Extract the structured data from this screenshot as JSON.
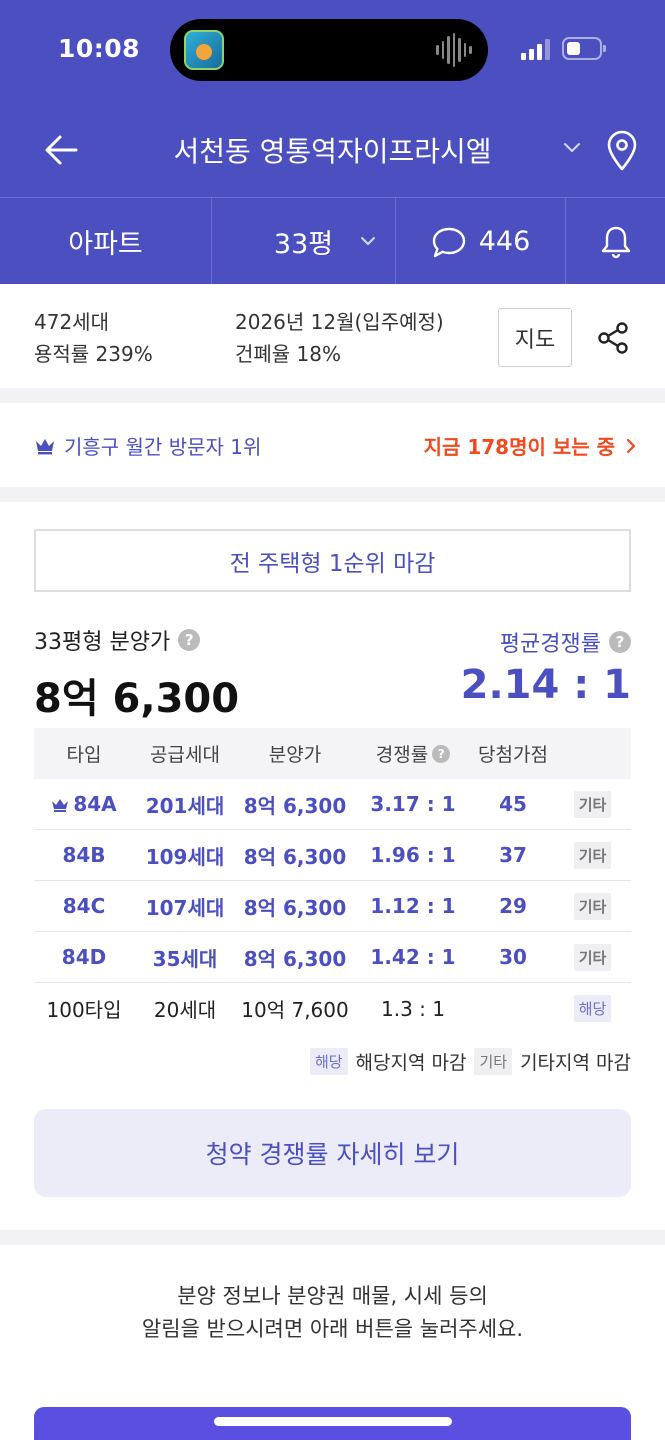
{
  "status_bar": {
    "time": "10:08"
  },
  "header": {
    "title": "서천동 영통역자이프라시엘",
    "tabs": {
      "type": "아파트",
      "size": "33평",
      "comments": "446"
    }
  },
  "info": {
    "households": "472세대",
    "far": "용적률 239%",
    "move_in": "2026년 12월(입주예정)",
    "bcr": "건폐율 18%",
    "map_label": "지도"
  },
  "visit": {
    "rank_text": "기흥구 월간 방문자 1위",
    "viewing_text": "지금 178명이 보는 중"
  },
  "subscription": {
    "closed_text": "전 주택형 1순위 마감",
    "price_label": "33평형 분양가",
    "price_value": "8억 6,300",
    "comp_label": "평균경쟁률",
    "comp_value": "2.14 : 1",
    "table": {
      "headers": [
        "타입",
        "공급세대",
        "분양가",
        "경쟁률",
        "당첨가점"
      ],
      "rows": [
        {
          "type": "84A",
          "supply": "201세대",
          "price": "8억 6,300",
          "ratio": "3.17 : 1",
          "score": "45",
          "tag": "기타"
        },
        {
          "type": "84B",
          "supply": "109세대",
          "price": "8억 6,300",
          "ratio": "1.96 : 1",
          "score": "37",
          "tag": "기타"
        },
        {
          "type": "84C",
          "supply": "107세대",
          "price": "8억 6,300",
          "ratio": "1.12 : 1",
          "score": "29",
          "tag": "기타"
        },
        {
          "type": "84D",
          "supply": "35세대",
          "price": "8억 6,300",
          "ratio": "1.42 : 1",
          "score": "30",
          "tag": "기타"
        },
        {
          "type": "100타입",
          "supply": "20세대",
          "price": "10억 7,600",
          "ratio": "1.3 : 1",
          "score": "",
          "tag": "해당"
        }
      ]
    },
    "legend": {
      "local_tag": "해당",
      "local_text": "해당지역 마감",
      "other_tag": "기타",
      "other_text": "기타지역 마감"
    },
    "more_button": "청약 경쟁률 자세히 보기"
  },
  "notice": {
    "line1": "분양 정보나 분양권 매물, 시세 등의",
    "line2": "알림을 받으시려면 아래 버튼을 눌러주세요."
  },
  "colors": {
    "brand": "#4b4fbf",
    "accent_orange": "#f04a1e",
    "cta": "#5a4fe0"
  }
}
